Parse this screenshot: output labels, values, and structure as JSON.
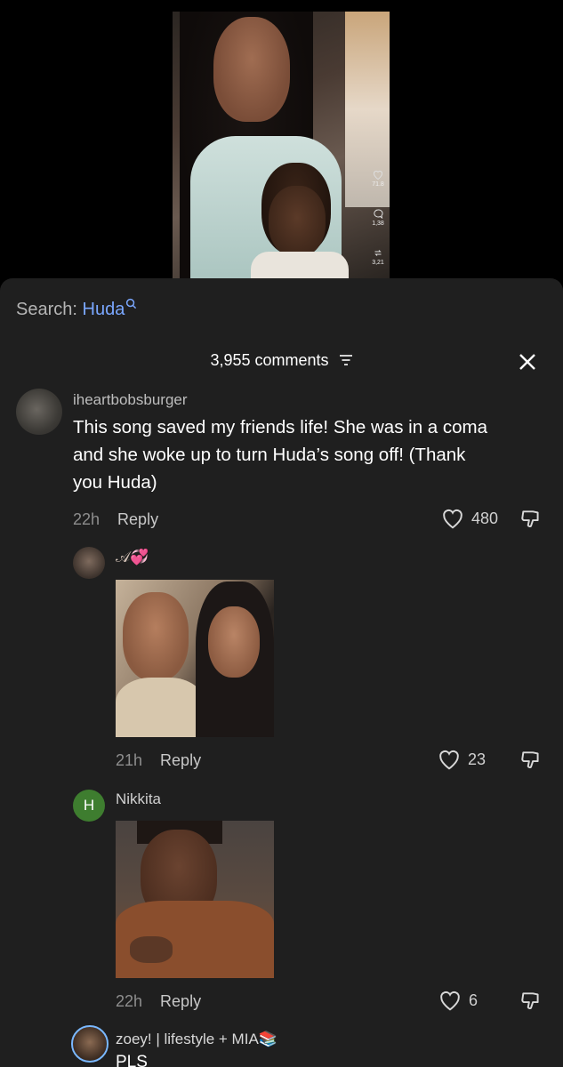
{
  "video": {
    "side_stats": [
      "71.8",
      "1,38",
      "3,21"
    ]
  },
  "search": {
    "prefix": "Search:",
    "term": "Huda"
  },
  "header": {
    "comments_count": "3,955 comments"
  },
  "comments": [
    {
      "username": "iheartbobsburger",
      "text_lines": [
        "This song saved my friends life! She was in a coma",
        "and she woke up to turn Huda’s song off! (Thank",
        "you Huda)"
      ],
      "time": "22h",
      "reply_label": "Reply",
      "likes": "480"
    }
  ],
  "replies": [
    {
      "username": "𝒜💞",
      "time": "21h",
      "reply_label": "Reply",
      "likes": "23"
    },
    {
      "username": "Nikkita",
      "avatar_letter": "H",
      "time": "22h",
      "reply_label": "Reply",
      "likes": "6"
    },
    {
      "username": "zoey! | lifestyle + MIA📚",
      "text_partial": "PLS"
    }
  ],
  "colors": {
    "sheet_bg": "#1f1f1f",
    "accent_search": "#7aa7ff",
    "avatar_green": "#3e7d2f"
  }
}
